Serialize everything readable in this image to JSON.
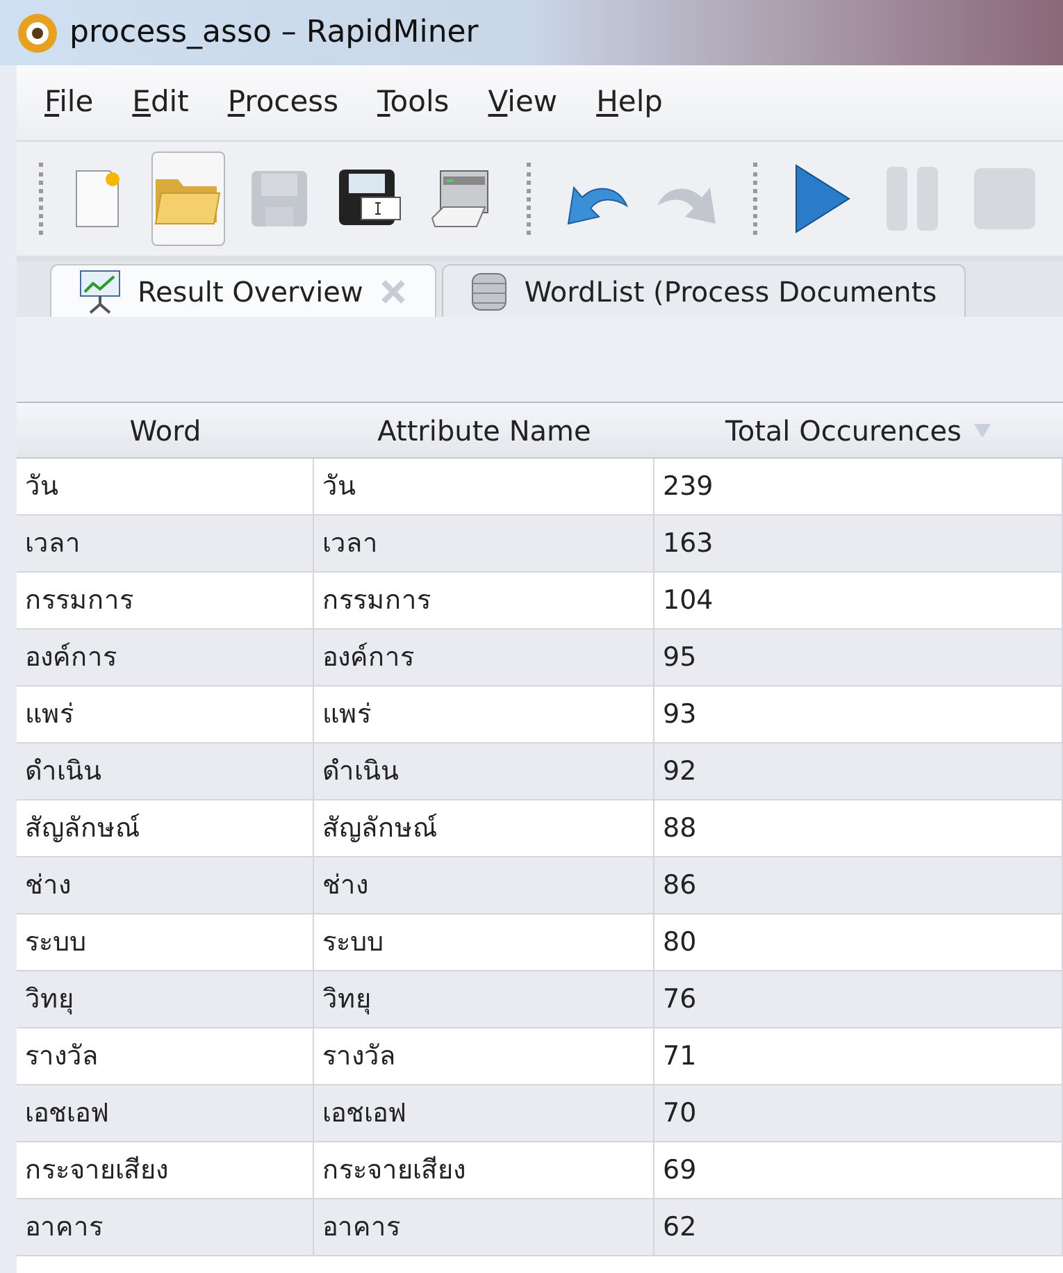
{
  "window": {
    "title": "process_asso – RapidMiner"
  },
  "menu": [
    {
      "label": "File"
    },
    {
      "label": "Edit"
    },
    {
      "label": "Process"
    },
    {
      "label": "Tools"
    },
    {
      "label": "View"
    },
    {
      "label": "Help"
    }
  ],
  "toolbar": [
    {
      "kind": "new",
      "disabled": false,
      "hovered": false
    },
    {
      "kind": "open",
      "disabled": false,
      "hovered": true
    },
    {
      "kind": "save",
      "disabled": true,
      "hovered": false
    },
    {
      "kind": "saveas",
      "disabled": false,
      "hovered": false
    },
    {
      "kind": "print",
      "disabled": false,
      "hovered": false
    },
    {
      "kind": "separator"
    },
    {
      "kind": "undo",
      "disabled": false,
      "hovered": false
    },
    {
      "kind": "redo",
      "disabled": true,
      "hovered": false
    },
    {
      "kind": "separator"
    },
    {
      "kind": "run",
      "disabled": false,
      "hovered": false
    },
    {
      "kind": "pause",
      "disabled": true,
      "hovered": false
    },
    {
      "kind": "stop",
      "disabled": true,
      "hovered": false
    }
  ],
  "tabs": [
    {
      "label": "Result Overview",
      "kind": "chart",
      "selected": true,
      "closable": true
    },
    {
      "label": "WordList (Process Documents",
      "kind": "database",
      "selected": false,
      "closable": false
    }
  ],
  "table": {
    "columns": [
      {
        "label": "Word",
        "sorted": false
      },
      {
        "label": "Attribute Name",
        "sorted": false
      },
      {
        "label": "Total Occurences",
        "sorted": true
      }
    ],
    "rows": [
      [
        "วัน",
        "วัน",
        "239"
      ],
      [
        "เวลา",
        "เวลา",
        "163"
      ],
      [
        "กรรมการ",
        "กรรมการ",
        "104"
      ],
      [
        "องค์การ",
        "องค์การ",
        "95"
      ],
      [
        "แพร่",
        "แพร่",
        "93"
      ],
      [
        "ดำเนิน",
        "ดำเนิน",
        "92"
      ],
      [
        "สัญลักษณ์",
        "สัญลักษณ์",
        "88"
      ],
      [
        "ช่าง",
        "ช่าง",
        "86"
      ],
      [
        "ระบบ",
        "ระบบ",
        "80"
      ],
      [
        "วิทยุ",
        "วิทยุ",
        "76"
      ],
      [
        "รางวัล",
        "รางวัล",
        "71"
      ],
      [
        "เอชเอฟ",
        "เอชเอฟ",
        "70"
      ],
      [
        "กระจายเสียง",
        "กระจายเสียง",
        "69"
      ],
      [
        "อาคาร",
        "อาคาร",
        "62"
      ]
    ]
  }
}
